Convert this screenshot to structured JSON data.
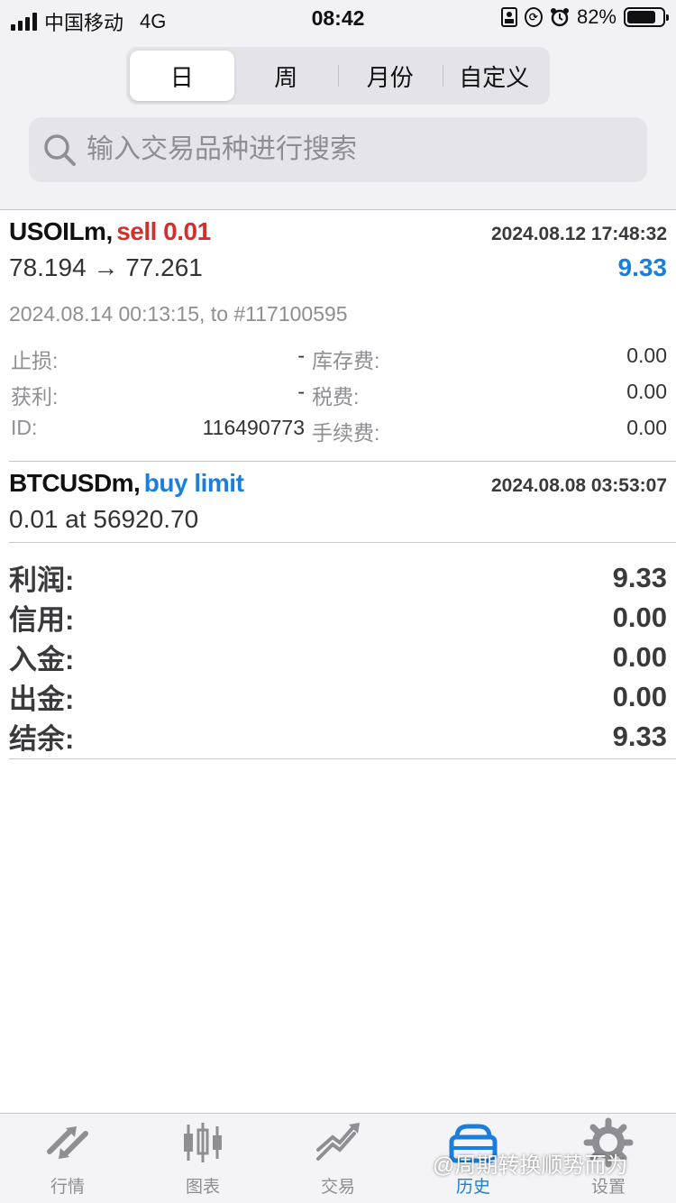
{
  "status": {
    "carrier": "中国移动",
    "network": "4G",
    "time": "08:42",
    "battery": "82%",
    "battery_level": 0.82
  },
  "periods": [
    {
      "label": "日",
      "active": true
    },
    {
      "label": "周",
      "active": false
    },
    {
      "label": "月份",
      "active": false
    },
    {
      "label": "自定义",
      "active": false
    }
  ],
  "search": {
    "placeholder": "输入交易品种进行搜索"
  },
  "trades": [
    {
      "symbol": "USOILm,",
      "action": "sell 0.01",
      "open_time": "2024.08.12 17:48:32",
      "price_text": "78.194 → 77.261",
      "profit": "9.33",
      "close_info": "2024.08.14 00:13:15, to #117100595",
      "labels": {
        "stop_loss": "止损:",
        "take_profit": "获利:",
        "id": "ID:",
        "swap": "库存费:",
        "taxes": "税费:",
        "commission": "手续费:"
      },
      "values": {
        "stop_loss": "-",
        "take_profit": "-",
        "id": "116490773",
        "swap": "0.00",
        "taxes": "0.00",
        "commission": "0.00"
      }
    },
    {
      "symbol": "BTCUSDm,",
      "action": "buy limit",
      "open_time": "2024.08.08 03:53:07",
      "price_text": "0.01 at 56920.70"
    }
  ],
  "summary": [
    {
      "label": "利润:",
      "value": "9.33"
    },
    {
      "label": "信用:",
      "value": "0.00"
    },
    {
      "label": "入金:",
      "value": "0.00"
    },
    {
      "label": "出金:",
      "value": "0.00"
    },
    {
      "label": "结余:",
      "value": "9.33"
    }
  ],
  "tabs": [
    {
      "label": "行情",
      "icon": "quotes-arrows-icon"
    },
    {
      "label": "图表",
      "icon": "candlestick-chart-icon"
    },
    {
      "label": "交易",
      "icon": "trade-trend-icon"
    },
    {
      "label": "历史",
      "icon": "history-briefcase-icon",
      "active": true
    },
    {
      "label": "设置",
      "icon": "gear-icon"
    }
  ],
  "watermark": "@周期转换顺势而为",
  "colors": {
    "accent": "#1a7fdc",
    "sell": "#d0312d",
    "buy": "#1a7fdc"
  }
}
